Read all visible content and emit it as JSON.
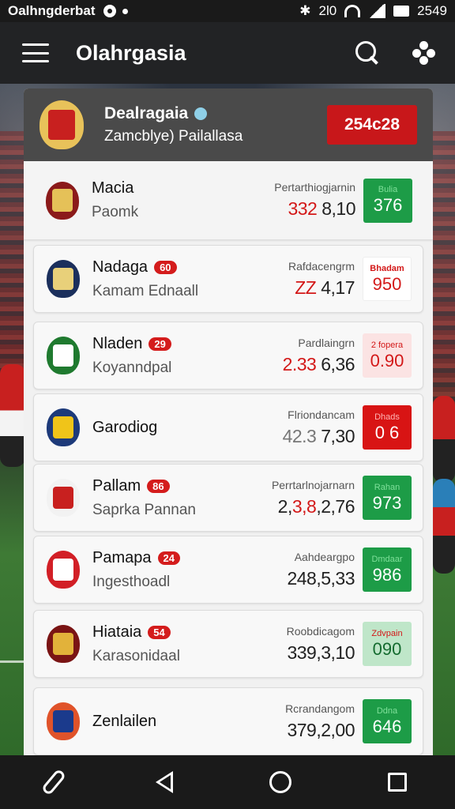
{
  "status_bar": {
    "carrier": "Oalhngderbat",
    "time": "2549",
    "network": "2l0"
  },
  "app_bar": {
    "title": "Olahrgasia"
  },
  "match_header": {
    "team_name": "Dealragaia",
    "subtitle": "Zamcblye) Pailallasa",
    "score": "254c28"
  },
  "rows": [
    {
      "name": "Macia",
      "badge": "",
      "sub": "Paomk",
      "label": "Pertarthiogjarnin",
      "num_parts": [
        {
          "t": "332",
          "c": "r"
        },
        {
          "t": " 8,10",
          "c": ""
        }
      ],
      "box_label": "Bulia",
      "box_value": "376",
      "box_style": "green",
      "crest_color": "#8b1a1a",
      "crest_inner": "#e5c158"
    },
    {
      "name": "Nadaga",
      "badge": "60",
      "sub": "Kamam Ednaall",
      "label": "Rafdacengrm",
      "num_parts": [
        {
          "t": "ZZ",
          "c": "r"
        },
        {
          "t": " 4,17",
          "c": ""
        }
      ],
      "box_label": "Bhadam",
      "box_value": "950",
      "box_style": "white",
      "crest_color": "#1b2f5c",
      "crest_inner": "#e8d07a"
    },
    {
      "name": "Nladen",
      "badge": "29",
      "sub": "Koyanndpal",
      "label": "Pardlaingrn",
      "num_parts": [
        {
          "t": "2.33",
          "c": "r"
        },
        {
          "t": " 6,36",
          "c": ""
        }
      ],
      "box_label": "2 fopera",
      "box_value": "0.90",
      "box_style": "pink",
      "crest_color": "#1f7a2f",
      "crest_inner": "#ffffff"
    },
    {
      "name": "Garodiog",
      "badge": "",
      "sub": "",
      "label": "Flriondancam",
      "num_parts": [
        {
          "t": "42.3",
          "c": "g"
        },
        {
          "t": " 7,30",
          "c": ""
        }
      ],
      "box_label": "Dhads",
      "box_value": "0 6",
      "box_style": "red",
      "crest_color": "#1d3a7a",
      "crest_inner": "#f0c419"
    },
    {
      "name": "Pallam",
      "badge": "86",
      "sub": "Saprka Pannan",
      "label": "Perrtarlnojarnarn",
      "num_parts": [
        {
          "t": "2,",
          "c": ""
        },
        {
          "t": "3,8",
          "c": "r"
        },
        {
          "t": ",2,76",
          "c": ""
        }
      ],
      "box_label": "Rahan",
      "box_value": "973",
      "box_style": "green",
      "crest_color": "#f2f2f2",
      "crest_inner": "#c8201f"
    },
    {
      "name": "Pamapa",
      "badge": "24",
      "sub": "Ingesthoadl",
      "label": "Aahdeargpo",
      "num_parts": [
        {
          "t": "248,5,33",
          "c": ""
        }
      ],
      "box_label": "Dmdaar",
      "box_value": "986",
      "box_style": "green",
      "crest_color": "#d21f26",
      "crest_inner": "#ffffff"
    },
    {
      "name": "Hiataia",
      "badge": "54",
      "sub": "Karasonidaal",
      "label": "Roobdicagom",
      "num_parts": [
        {
          "t": "339,3,10",
          "c": ""
        }
      ],
      "box_label": "Zdvpain",
      "box_value": "090",
      "box_style": "mint",
      "crest_color": "#7a1414",
      "crest_inner": "#e2b23a"
    },
    {
      "name": "Zenlailen",
      "badge": "",
      "sub": "",
      "label": "Rcrandangom",
      "num_parts": [
        {
          "t": "379,2,00",
          "c": ""
        }
      ],
      "box_label": "Ddna",
      "box_value": "646",
      "box_style": "green",
      "crest_color": "#e0532a",
      "crest_inner": "#1b3a8c"
    }
  ],
  "colors": {
    "accent_red": "#d41c1c",
    "accent_green": "#1d9c47",
    "header_bg": "#4a4a4a",
    "app_bar_bg": "#222325"
  },
  "icons": {
    "menu": "menu-icon",
    "search": "search-icon",
    "settings": "settings-icon",
    "nav": [
      "paperclip-icon",
      "back-icon",
      "home-icon",
      "recents-icon"
    ]
  }
}
